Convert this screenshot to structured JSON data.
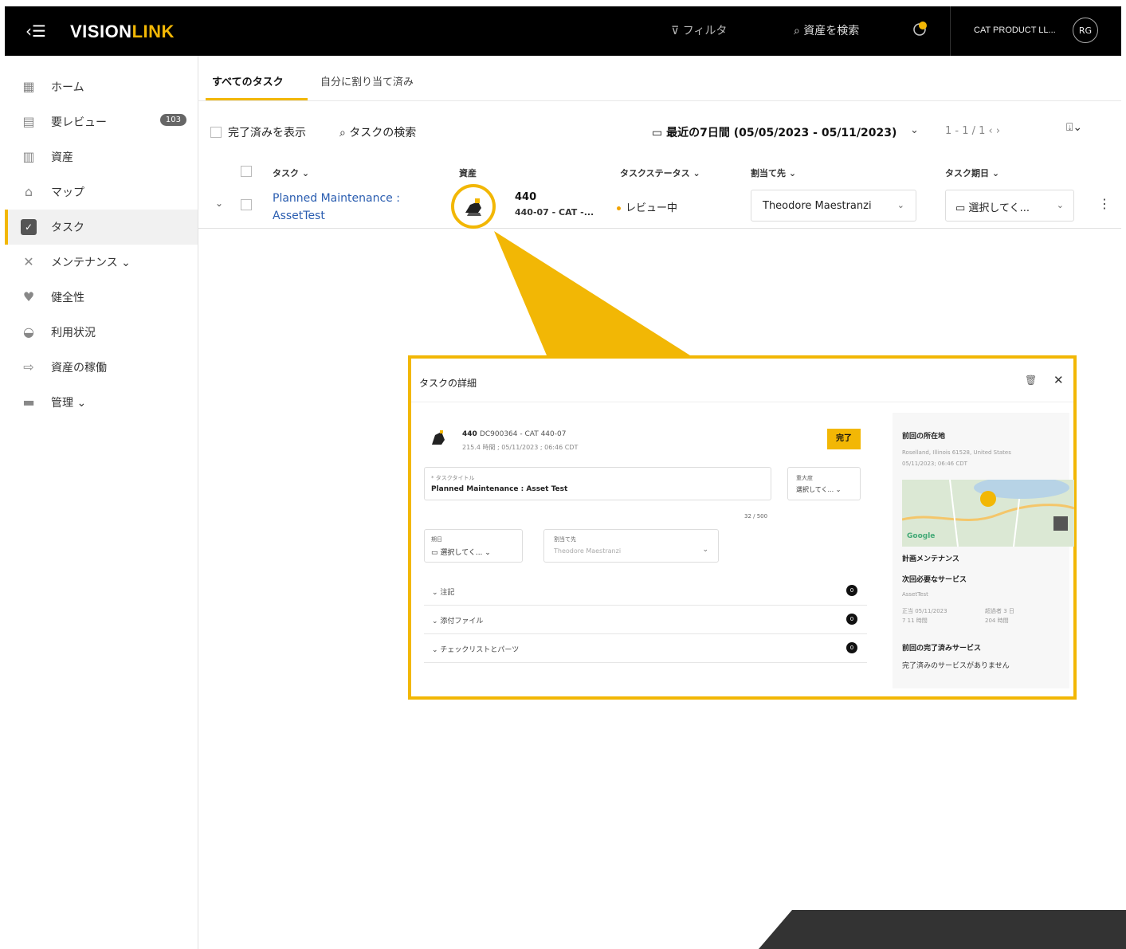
{
  "topbar": {
    "logo_main": "VISION",
    "logo_accent": "LINK",
    "filter_label": "フィルタ",
    "search_label": "資産を検索",
    "account_name": "CAT PRODUCT LL...",
    "avatar_initials": "RG"
  },
  "sidebar": {
    "items": [
      {
        "label": "ホーム",
        "icon": "grid-icon"
      },
      {
        "label": "要レビュー",
        "icon": "review-icon",
        "badge": "103"
      },
      {
        "label": "資産",
        "icon": "asset-icon"
      },
      {
        "label": "マップ",
        "icon": "map-icon"
      },
      {
        "label": "タスク",
        "icon": "task-icon",
        "active": true
      },
      {
        "label": "メンテナンス ⌄",
        "icon": "tools-icon"
      },
      {
        "label": "健全性",
        "icon": "heart-icon"
      },
      {
        "label": "利用状況",
        "icon": "gauge-icon"
      },
      {
        "label": "資産の稼働",
        "icon": "operation-icon"
      },
      {
        "label": "管理 ⌄",
        "icon": "briefcase-icon"
      }
    ]
  },
  "tabs": {
    "all": "すべてのタスク",
    "assigned": "自分に割り当て済み"
  },
  "toolbar": {
    "show_completed": "完了済みを表示",
    "search": "タスクの検索",
    "date_range": "最近の7日間 (05/05/2023 - 05/11/2023)",
    "pager": "1 - 1 / 1"
  },
  "table": {
    "headers": {
      "task": "タスク ⌄",
      "asset": "資産",
      "status": "タスクステータス ⌄",
      "assignee": "割当て先 ⌄",
      "due": "タスク期日 ⌄"
    },
    "row": {
      "task_line1": "Planned Maintenance :",
      "task_line2": "AssetTest",
      "asset_name": "440",
      "asset_sub": "440-07 - CAT -...",
      "status": "レビュー中",
      "assignee": "Theodore Maestranzi",
      "due": "選択してく..."
    }
  },
  "panel": {
    "title": "タスクの詳細",
    "asset_name": "440",
    "asset_serial": "DC900364 - CAT 440-07",
    "asset_meta": "215.4 時間 ; 05/11/2023 ; 06:46 CDT",
    "complete_label": "完了",
    "title_field_label": "* タスクタイトル",
    "title_field_value": "Planned Maintenance : Asset Test",
    "title_count": "32 / 500",
    "priority_label": "重大度",
    "priority_value": "選択してく... ⌄",
    "due_label": "期日",
    "due_value": "選択してく...",
    "assignee_label": "割当て先",
    "assignee_value": "Theodore Maestranzi",
    "accordions": [
      {
        "label": "注記",
        "count": "0"
      },
      {
        "label": "添付ファイル",
        "count": "0"
      },
      {
        "label": "チェックリストとパーツ",
        "count": "0"
      }
    ],
    "side": {
      "location_heading": "前回の所在地",
      "location_address": "Roselland, Illinois 61528, United States",
      "location_time": "05/11/2023; 06:46 CDT",
      "map_label_google": "Google",
      "planned_heading": "計画メンテナンス",
      "next_service_heading": "次回必要なサービス",
      "next_service_name": "AssetTest",
      "next_service_due": "正当 05/11/2023",
      "next_service_hours": "7 11 時間",
      "overdue": "超過者 3 日",
      "overdue_hours": "204 時間",
      "last_service_heading": "前回の完了済みサービス",
      "last_service_none": "完了済みのサービスがありません"
    }
  },
  "colors": {
    "accent": "#f2b705",
    "link": "#2a5db0",
    "topbar": "#000000"
  }
}
